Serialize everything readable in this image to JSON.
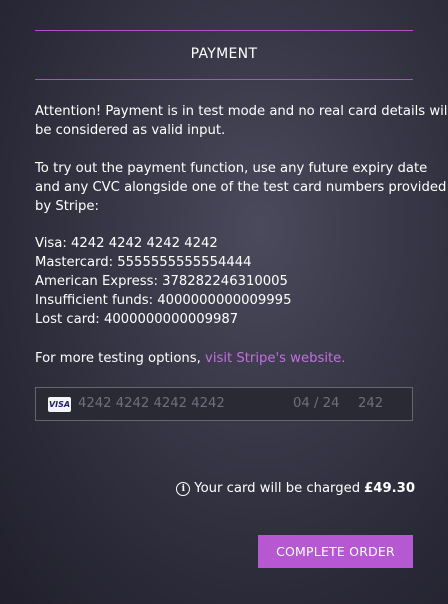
{
  "payment": {
    "heading": "PAYMENT",
    "notice": [
      "Attention! Payment is in test mode and no real card details will",
      "be considered as valid input."
    ],
    "instructions": [
      "To try out the payment function, use any future expiry date",
      "and any CVC alongside one of the test card numbers provided",
      "by Stripe:"
    ],
    "test_cards": [
      "Visa: 4242 4242 4242 4242",
      "Mastercard: 5555555555554444",
      "American Express: 378282246310005",
      "Insufficient funds: 4000000000009995",
      "Lost card: 4000000000009987"
    ],
    "more_options_text": "For more testing options, ",
    "stripe_link": "visit Stripe's website."
  },
  "card_field": {
    "brand": "VISA",
    "brand_icon": "visa-card-icon",
    "number_placeholder": "4242 4242 4242 4242",
    "expiry_placeholder": "04 / 24",
    "cvc_placeholder": "242"
  },
  "charge": {
    "icon": "info-icon",
    "text": "Your card will be charged",
    "amount": "£49.30"
  },
  "actions": {
    "complete_order": "COMPLETE ORDER"
  },
  "colors": {
    "accent": "#b658d2",
    "link": "#c36fe0",
    "rule": "#b14fc5"
  }
}
